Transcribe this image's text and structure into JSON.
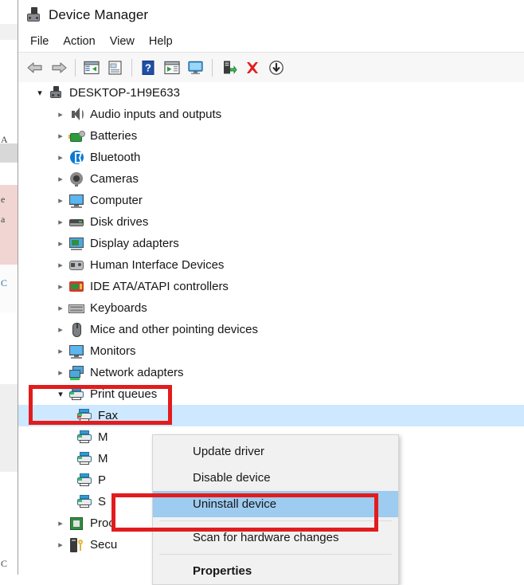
{
  "window": {
    "title": "Device Manager",
    "app_icon": "device-manager-icon"
  },
  "menubar": {
    "items": [
      {
        "label": "File",
        "name": "menu-file"
      },
      {
        "label": "Action",
        "name": "menu-action"
      },
      {
        "label": "View",
        "name": "menu-view"
      },
      {
        "label": "Help",
        "name": "menu-help"
      }
    ]
  },
  "toolbar": {
    "buttons": [
      {
        "name": "back-arrow-icon",
        "tooltip": "Back"
      },
      {
        "name": "forward-arrow-icon",
        "tooltip": "Forward"
      },
      {
        "name": "show-hide-console-tree-icon",
        "tooltip": "Show/Hide console tree"
      },
      {
        "name": "properties-icon",
        "tooltip": "Properties"
      },
      {
        "name": "help-icon",
        "tooltip": "Help"
      },
      {
        "name": "update-driver-icon",
        "tooltip": "Update driver"
      },
      {
        "name": "scan-hardware-changes-icon",
        "tooltip": "Scan for hardware changes"
      },
      {
        "name": "enable-device-icon",
        "tooltip": "Enable device"
      },
      {
        "name": "uninstall-device-icon",
        "tooltip": "Uninstall device"
      },
      {
        "name": "disable-device-icon",
        "tooltip": "Disable device"
      }
    ]
  },
  "tree": {
    "root": {
      "label": "DESKTOP-1H9E633",
      "expanded": true,
      "icon": "computer-root-icon"
    },
    "nodes": [
      {
        "label": "Audio inputs and outputs",
        "icon": "speaker-icon",
        "expanded": false
      },
      {
        "label": "Batteries",
        "icon": "battery-icon",
        "expanded": false
      },
      {
        "label": "Bluetooth",
        "icon": "bluetooth-icon",
        "expanded": false
      },
      {
        "label": "Cameras",
        "icon": "camera-icon",
        "expanded": false
      },
      {
        "label": "Computer",
        "icon": "computer-icon",
        "expanded": false
      },
      {
        "label": "Disk drives",
        "icon": "disk-drive-icon",
        "expanded": false
      },
      {
        "label": "Display adapters",
        "icon": "display-adapter-icon",
        "expanded": false
      },
      {
        "label": "Human Interface Devices",
        "icon": "hid-icon",
        "expanded": false
      },
      {
        "label": "IDE ATA/ATAPI controllers",
        "icon": "ide-controller-icon",
        "expanded": false
      },
      {
        "label": "Keyboards",
        "icon": "keyboard-icon",
        "expanded": false
      },
      {
        "label": "Mice and other pointing devices",
        "icon": "mouse-icon",
        "expanded": false
      },
      {
        "label": "Monitors",
        "icon": "monitor-icon",
        "expanded": false
      },
      {
        "label": "Network adapters",
        "icon": "network-adapter-icon",
        "expanded": false
      },
      {
        "label": "Print queues",
        "icon": "printer-icon",
        "expanded": true
      },
      {
        "label": "Proc",
        "icon": "processor-icon",
        "expanded": false
      },
      {
        "label": "Secu",
        "icon": "security-device-icon",
        "expanded": false
      }
    ],
    "print_queue_children": [
      {
        "label": "Fax",
        "icon": "printer-icon",
        "selected": true
      },
      {
        "label": "M",
        "icon": "printer-icon",
        "selected": false
      },
      {
        "label": "M",
        "icon": "printer-icon",
        "selected": false
      },
      {
        "label": "P",
        "icon": "printer-icon",
        "selected": false
      },
      {
        "label": "S",
        "icon": "printer-icon",
        "selected": false
      }
    ]
  },
  "context_menu": {
    "items": [
      {
        "label": "Update driver",
        "highlighted": false,
        "bold": false
      },
      {
        "label": "Disable device",
        "highlighted": false,
        "bold": false
      },
      {
        "label": "Uninstall device",
        "highlighted": true,
        "bold": false
      },
      {
        "label": "Scan for hardware changes",
        "highlighted": false,
        "bold": false
      },
      {
        "label": "Properties",
        "highlighted": false,
        "bold": true
      }
    ]
  },
  "annotations": {
    "color": "#e21c1c",
    "boxes": [
      {
        "name": "redbox-printqueues",
        "target": "Print queues"
      },
      {
        "name": "redbox-uninstall",
        "target": "Uninstall device"
      }
    ]
  },
  "background_page": {
    "fragments": [
      "A",
      "e",
      "a",
      "C",
      "C"
    ]
  }
}
